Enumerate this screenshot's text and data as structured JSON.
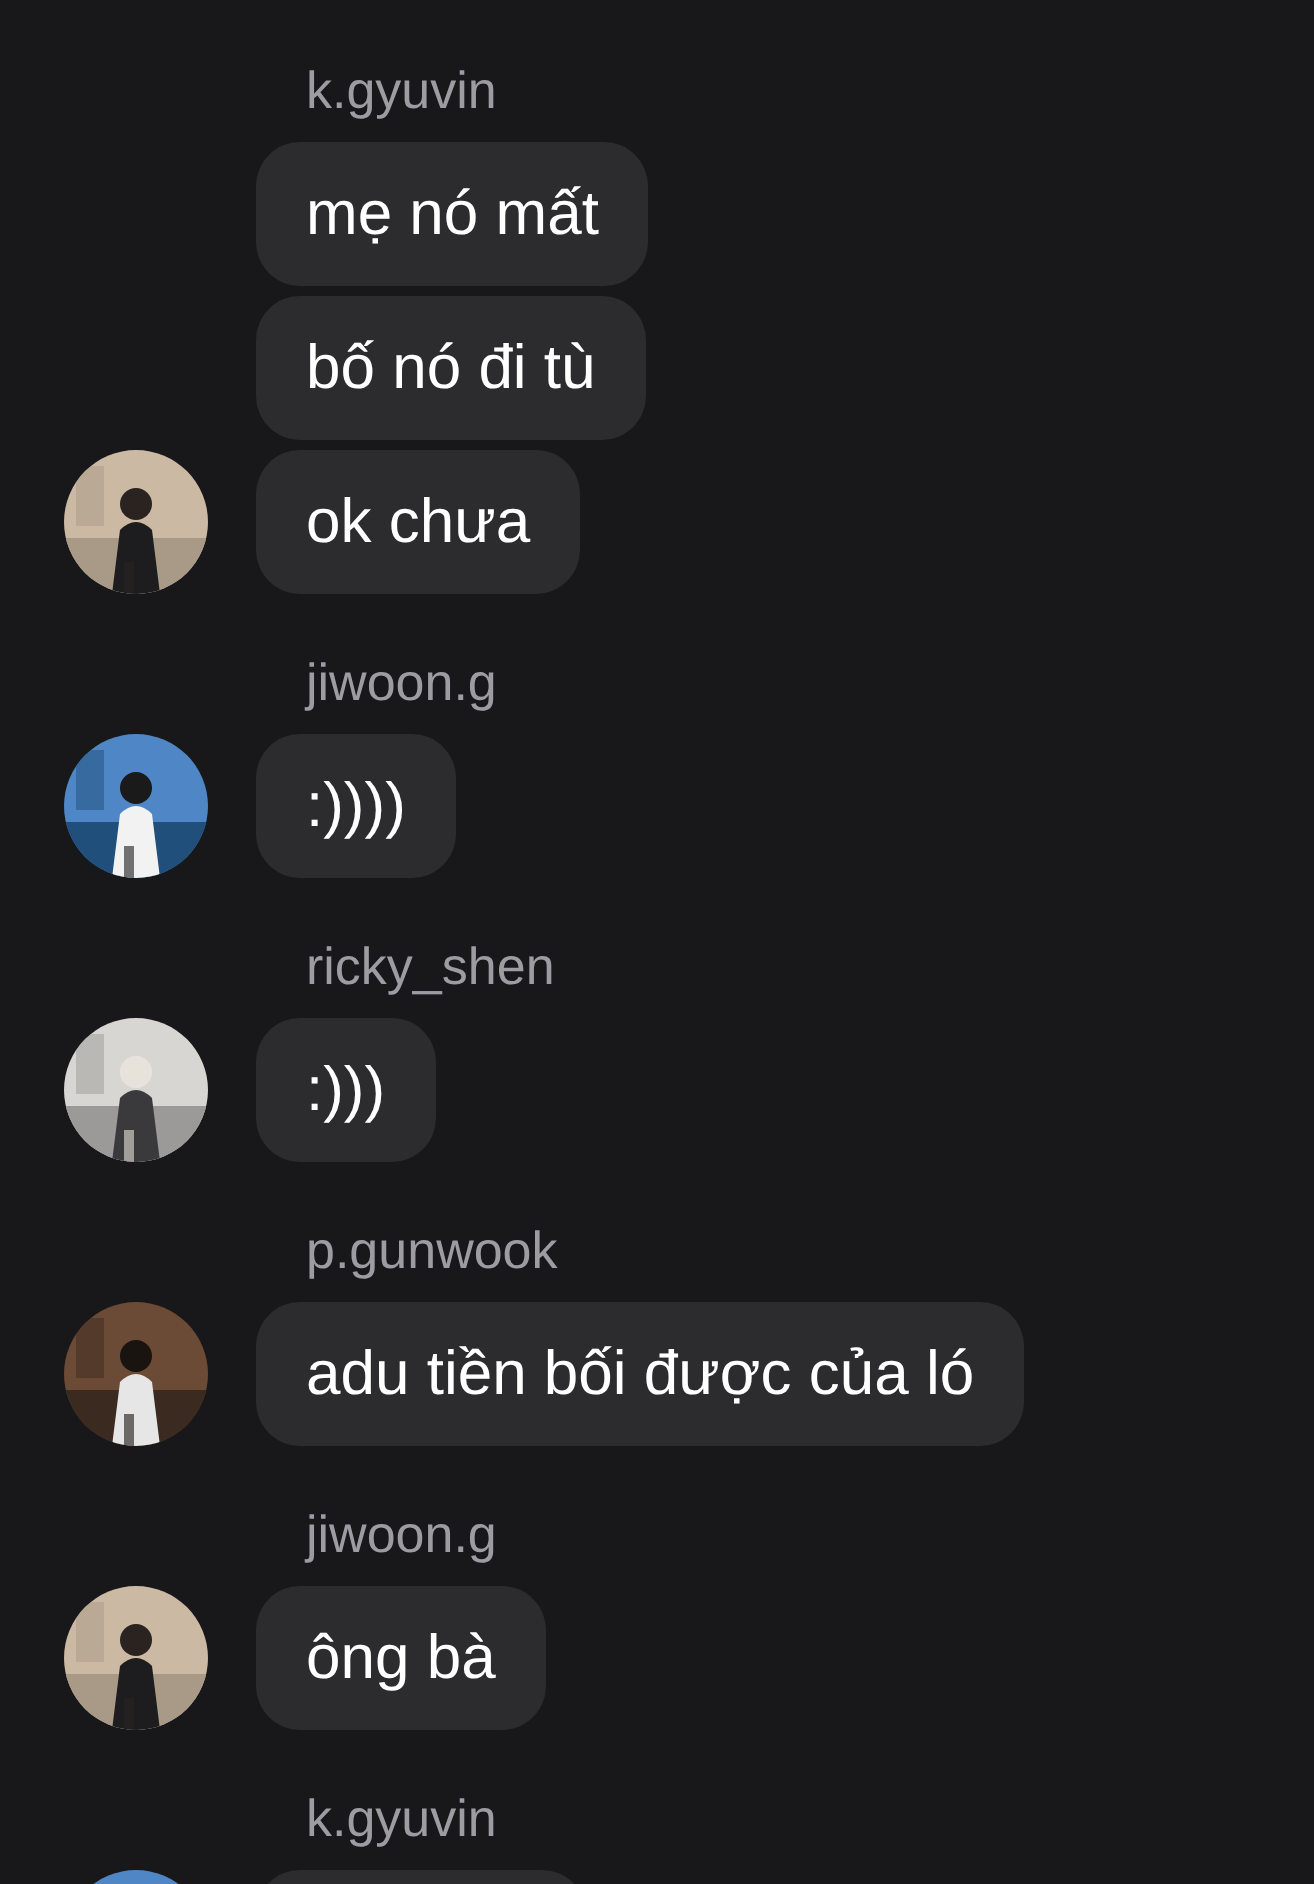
{
  "groups": [
    {
      "sender": "k.gyuvin",
      "messages": [
        "mẹ nó mất",
        "bố nó đi tù",
        "ok chưa"
      ]
    },
    {
      "sender": "jiwoon.g",
      "messages": [
        ":))))"
      ]
    },
    {
      "sender": "ricky_shen",
      "messages": [
        ":)))"
      ]
    },
    {
      "sender": "p.gunwook",
      "messages": [
        "adu tiền bối được của ló"
      ]
    },
    {
      "sender": "jiwoon.g",
      "messages": [
        "ông bà"
      ]
    },
    {
      "sender": "k.gyuvin",
      "cut_off": true
    }
  ]
}
